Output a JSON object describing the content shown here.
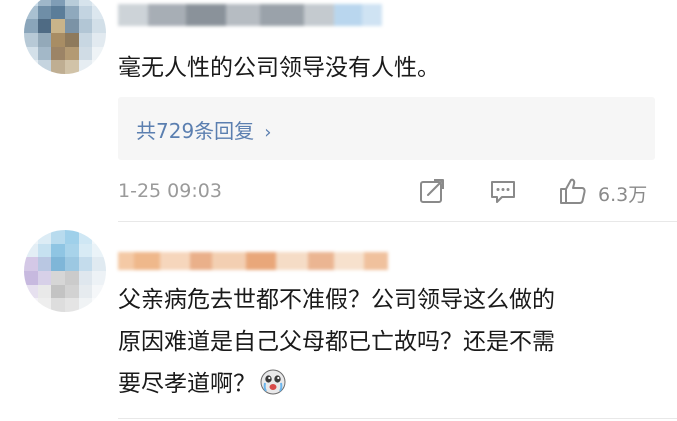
{
  "comments": [
    {
      "text": "毫无人性的公司领导没有人性。",
      "reply_summary": "共729条回复",
      "reply_chevron": "›",
      "timestamp": "1-25 09:03",
      "like_count": "6.3万"
    },
    {
      "text": "父亲病危去世都不准假？公司领导这么做的\n原因难道是自己父母都已亡故吗？还是不需\n要尽孝道啊？"
    }
  ],
  "icons": {
    "share": "share-icon",
    "reply": "comment-icon",
    "like": "thumbs-up-icon",
    "emoji": "crying-face-emoji-icon"
  },
  "colors": {
    "text": "#1a1a1a",
    "link": "#5b7fb0",
    "muted": "#9a9a9a",
    "reply_box_bg": "#f6f6f6"
  }
}
